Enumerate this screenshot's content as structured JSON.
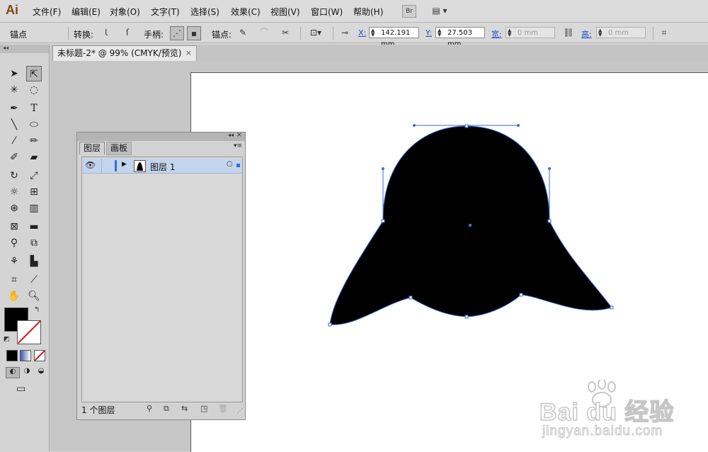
{
  "app": {
    "logo": "Ai"
  },
  "menu": [
    "文件(F)",
    "编辑(E)",
    "对象(O)",
    "文字(T)",
    "选择(S)",
    "效果(C)",
    "视图(V)",
    "窗口(W)",
    "帮助(H)"
  ],
  "menu_buttons": {
    "bridge": "Br",
    "arrange": "▤ ▾"
  },
  "control_bar": {
    "selection_label": "锚点",
    "convert_label": "转换:",
    "handles_label": "手柄:",
    "anchors_label": "锚点:",
    "x_label": "X:",
    "x_value": "142.191 mm",
    "y_label": "Y:",
    "y_value": "27.503 mm",
    "w_label": "宽:",
    "w_value": "0 mm",
    "h_label": "高:",
    "h_value": "0 mm"
  },
  "document": {
    "tab_title": "未标题-2* @ 99% (CMYK/预览)",
    "close": "×"
  },
  "layers_panel": {
    "tabs": [
      "图层",
      "画板"
    ],
    "layer_name": "图层 1",
    "footer_count": "1 个图层"
  },
  "watermark": {
    "brand": "Bai du 经验",
    "url": "jingyan.baidu.com"
  },
  "colors": {
    "fill": "#000000",
    "path_selection": "#3a6bd1",
    "artboard": "#ffffff",
    "layer_row": "#c3d5ec"
  }
}
